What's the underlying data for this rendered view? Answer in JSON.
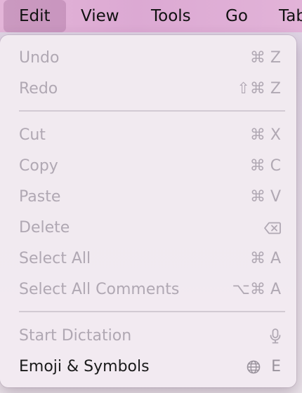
{
  "menubar": {
    "items": [
      {
        "label": "Edit",
        "active": true
      },
      {
        "label": "View"
      },
      {
        "label": "Tools"
      },
      {
        "label": "Go"
      },
      {
        "label": "Tab"
      }
    ]
  },
  "edit_menu": {
    "undo": {
      "label": "Undo",
      "shortcut": "⌘ Z",
      "enabled": false
    },
    "redo": {
      "label": "Redo",
      "shortcut": "⇧⌘ Z",
      "enabled": false
    },
    "cut": {
      "label": "Cut",
      "shortcut": "⌘ X",
      "enabled": false
    },
    "copy": {
      "label": "Copy",
      "shortcut": "⌘ C",
      "enabled": false
    },
    "paste": {
      "label": "Paste",
      "shortcut": "⌘ V",
      "enabled": false
    },
    "delete": {
      "label": "Delete",
      "shortcut_icon": "delete-key-icon",
      "enabled": false
    },
    "select_all": {
      "label": "Select All",
      "shortcut": "⌘ A",
      "enabled": false
    },
    "select_all_comments": {
      "label": "Select All Comments",
      "shortcut": "⌥⌘ A",
      "enabled": false
    },
    "start_dictation": {
      "label": "Start Dictation",
      "shortcut_icon": "microphone-icon",
      "enabled": false
    },
    "emoji_symbols": {
      "label": "Emoji & Symbols",
      "shortcut_icon": "globe-icon",
      "shortcut_key": "E",
      "enabled": true
    }
  },
  "colors": {
    "menubar_bg": "#dca9d3",
    "menu_bg": "#f1eaf0",
    "disabled_text": "#b0a8b3",
    "enabled_text": "#1a1a1a"
  }
}
